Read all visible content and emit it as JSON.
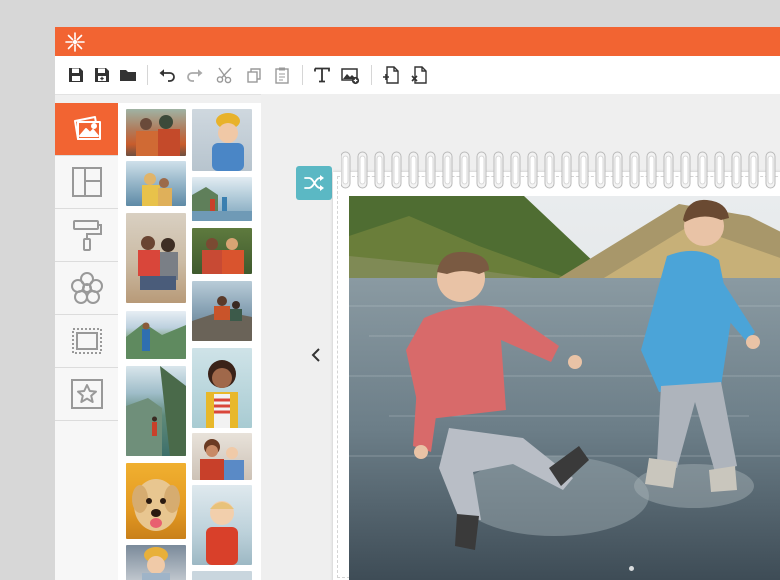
{
  "app": {
    "logo_icon": "sparkle-logo-icon",
    "accent_color": "#f26432",
    "toolbar": {
      "buttons": [
        {
          "name": "save-button",
          "icon": "floppy-disk-icon"
        },
        {
          "name": "save-as-button",
          "icon": "floppy-disk-plus-icon"
        },
        {
          "name": "open-folder-button",
          "icon": "folder-icon"
        },
        {
          "name": "undo-button",
          "icon": "undo-arrow-icon"
        },
        {
          "name": "redo-button",
          "icon": "redo-arrow-icon"
        },
        {
          "name": "cut-button",
          "icon": "scissors-icon"
        },
        {
          "name": "copy-button",
          "icon": "copy-icon"
        },
        {
          "name": "paste-button",
          "icon": "clipboard-icon"
        },
        {
          "name": "add-text-button",
          "icon": "text-T-icon"
        },
        {
          "name": "add-image-button",
          "icon": "image-plus-icon"
        },
        {
          "name": "add-page-button",
          "icon": "page-plus-icon"
        },
        {
          "name": "delete-page-button",
          "icon": "page-x-icon"
        }
      ]
    },
    "sidebar": {
      "items": [
        {
          "name": "photos",
          "icon": "photos-stack-icon",
          "active": true
        },
        {
          "name": "layouts",
          "icon": "layout-grid-icon",
          "active": false
        },
        {
          "name": "backgrounds",
          "icon": "paint-roller-icon",
          "active": false
        },
        {
          "name": "embellishments",
          "icon": "flower-icon",
          "active": false
        },
        {
          "name": "frames",
          "icon": "stamp-frame-icon",
          "active": false
        },
        {
          "name": "stickers",
          "icon": "star-frame-icon",
          "active": false
        }
      ]
    },
    "photo_library": {
      "thumbnails": [
        "family-hug-outdoors",
        "toddler-yellow-hat",
        "mother-child-lake",
        "kids-on-dock",
        "father-child-beach",
        "couple-autumn",
        "hiker-mountain-view",
        "hikers-on-rock",
        "hiker-lake-cliff",
        "woman-smiling-yellow",
        "fjord-hiker",
        "grandma-child",
        "golden-retriever",
        "toddler-window",
        "toddler-beanie"
      ]
    },
    "canvas": {
      "shuffle_icon": "shuffle-icon",
      "prev_icon": "chevron-left-icon",
      "main_photo": "two-boys-splashing-lake"
    }
  }
}
